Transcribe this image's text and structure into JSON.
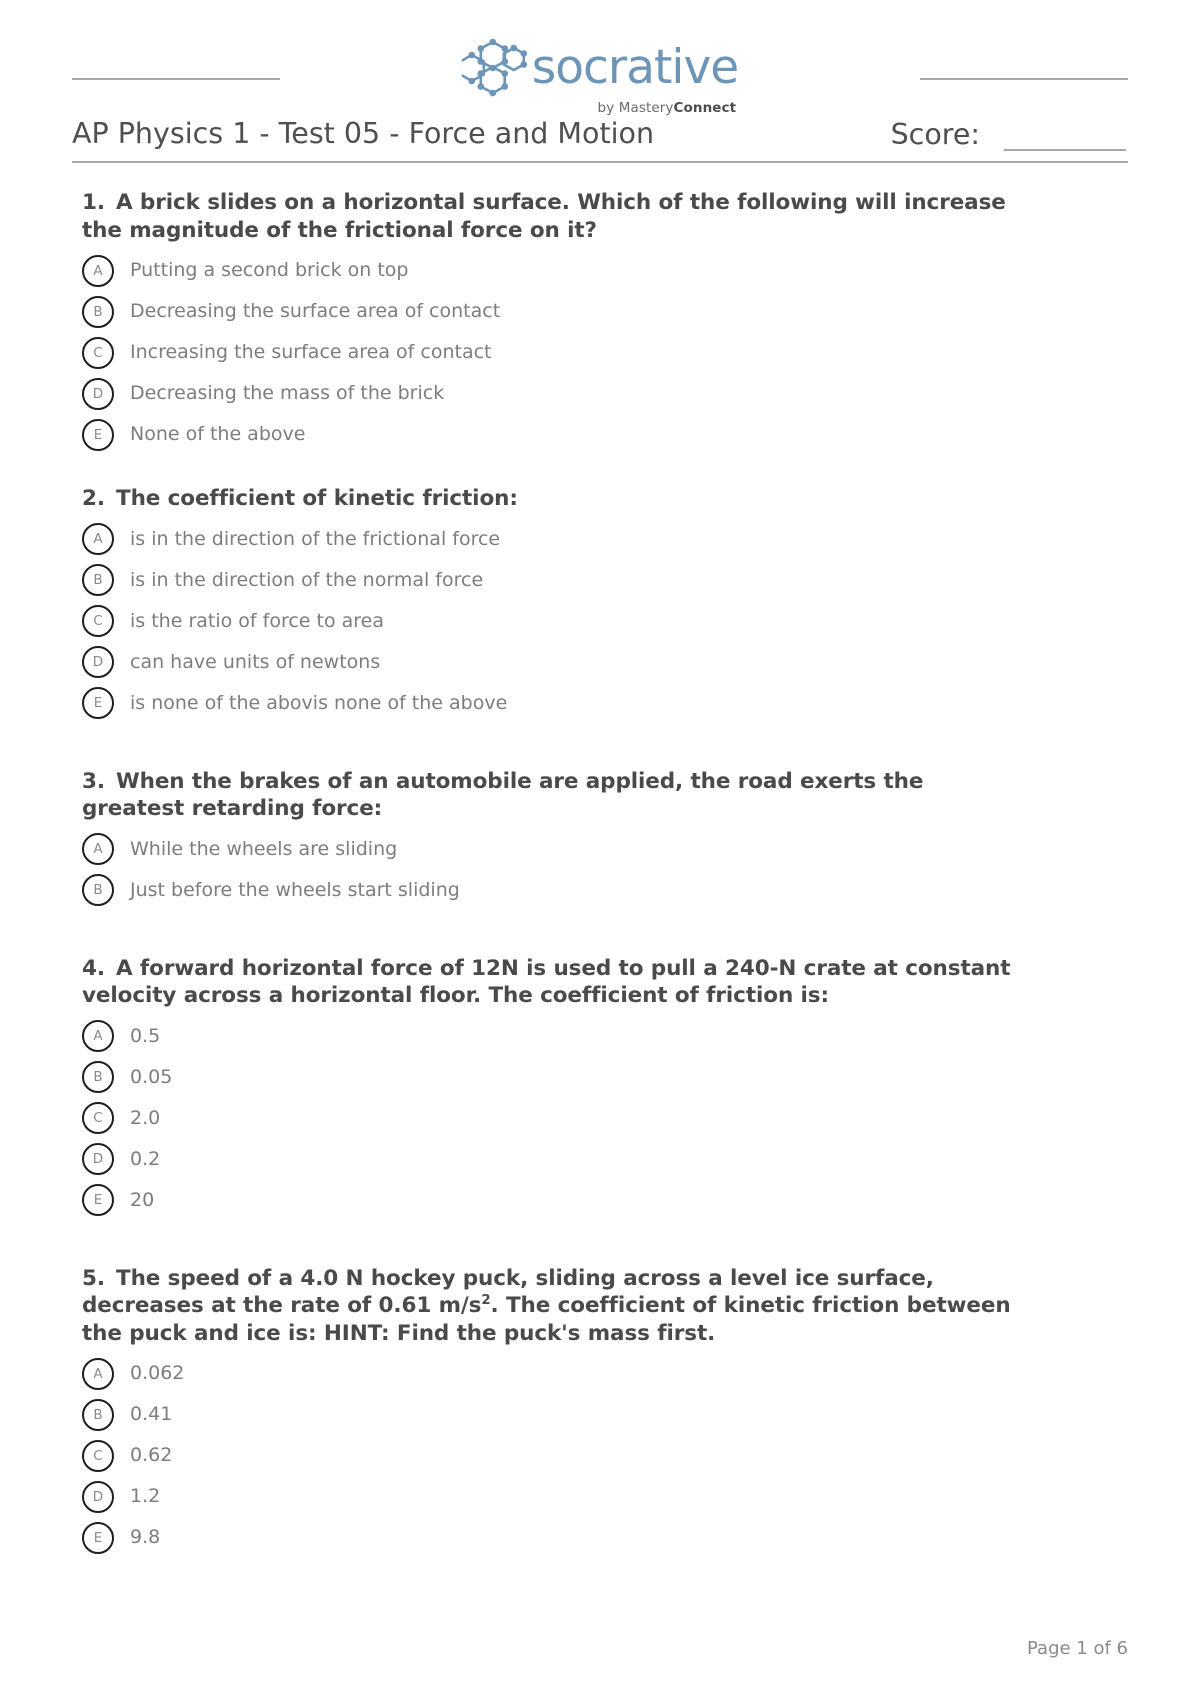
{
  "header": {
    "logo_word": "socrative",
    "logo_sub_prefix": "by Mastery",
    "logo_sub_bold": "Connect",
    "logo_icon": "hexagon-molecule-icon",
    "logo_color": "#6d95b8"
  },
  "title": {
    "doc_title": "AP Physics 1 - Test 05 - Force and Motion",
    "score_label": "Score:"
  },
  "questions": [
    {
      "number": "1.",
      "text": "A brick slides on a horizontal surface. Which of the following will increase the magnitude of the frictional force on it?",
      "options": [
        {
          "letter": "A",
          "text": "Putting a second brick on top"
        },
        {
          "letter": "B",
          "text": "Decreasing the surface area of contact"
        },
        {
          "letter": "C",
          "text": "Increasing the surface area of contact"
        },
        {
          "letter": "D",
          "text": "Decreasing the mass of the brick"
        },
        {
          "letter": "E",
          "text": "None of the above"
        }
      ]
    },
    {
      "number": "2.",
      "text": "The coefficient of kinetic friction:",
      "options": [
        {
          "letter": "A",
          "text": "is in the direction of the frictional force"
        },
        {
          "letter": "B",
          "text": "is in the direction of the normal force"
        },
        {
          "letter": "C",
          "text": "is the ratio of force to area"
        },
        {
          "letter": "D",
          "text": "can have units of newtons"
        },
        {
          "letter": "E",
          "text": "is none of the abovis none of the above"
        }
      ]
    },
    {
      "number": "3.",
      "text": "When the brakes of an automobile are applied, the road exerts the greatest retarding force:",
      "options": [
        {
          "letter": "A",
          "text": "While the wheels are sliding"
        },
        {
          "letter": "B",
          "text": "Just before the wheels start sliding"
        }
      ]
    },
    {
      "number": "4.",
      "text": "A forward horizontal force of 12N is used to pull a 240-N crate at constant velocity across a horizontal floor. The coefficient of friction is:",
      "options": [
        {
          "letter": "A",
          "text": "0.5"
        },
        {
          "letter": "B",
          "text": "0.05"
        },
        {
          "letter": "C",
          "text": "2.0"
        },
        {
          "letter": "D",
          "text": "0.2"
        },
        {
          "letter": "E",
          "text": "20"
        }
      ]
    },
    {
      "number": "5.",
      "text_part1": "The speed of a 4.0 N hockey puck, sliding across a level ice surface, decreases at the rate of 0.61 m/s",
      "text_sup": "2",
      "text_part2": ". The coefficient of kinetic friction between the puck and ice is: HINT: Find the puck's mass first.",
      "options": [
        {
          "letter": "A",
          "text": "0.062"
        },
        {
          "letter": "B",
          "text": "0.41"
        },
        {
          "letter": "C",
          "text": "0.62"
        },
        {
          "letter": "D",
          "text": "1.2"
        },
        {
          "letter": "E",
          "text": "9.8"
        }
      ]
    }
  ],
  "footer": {
    "page_text": "Page 1 of 6"
  }
}
